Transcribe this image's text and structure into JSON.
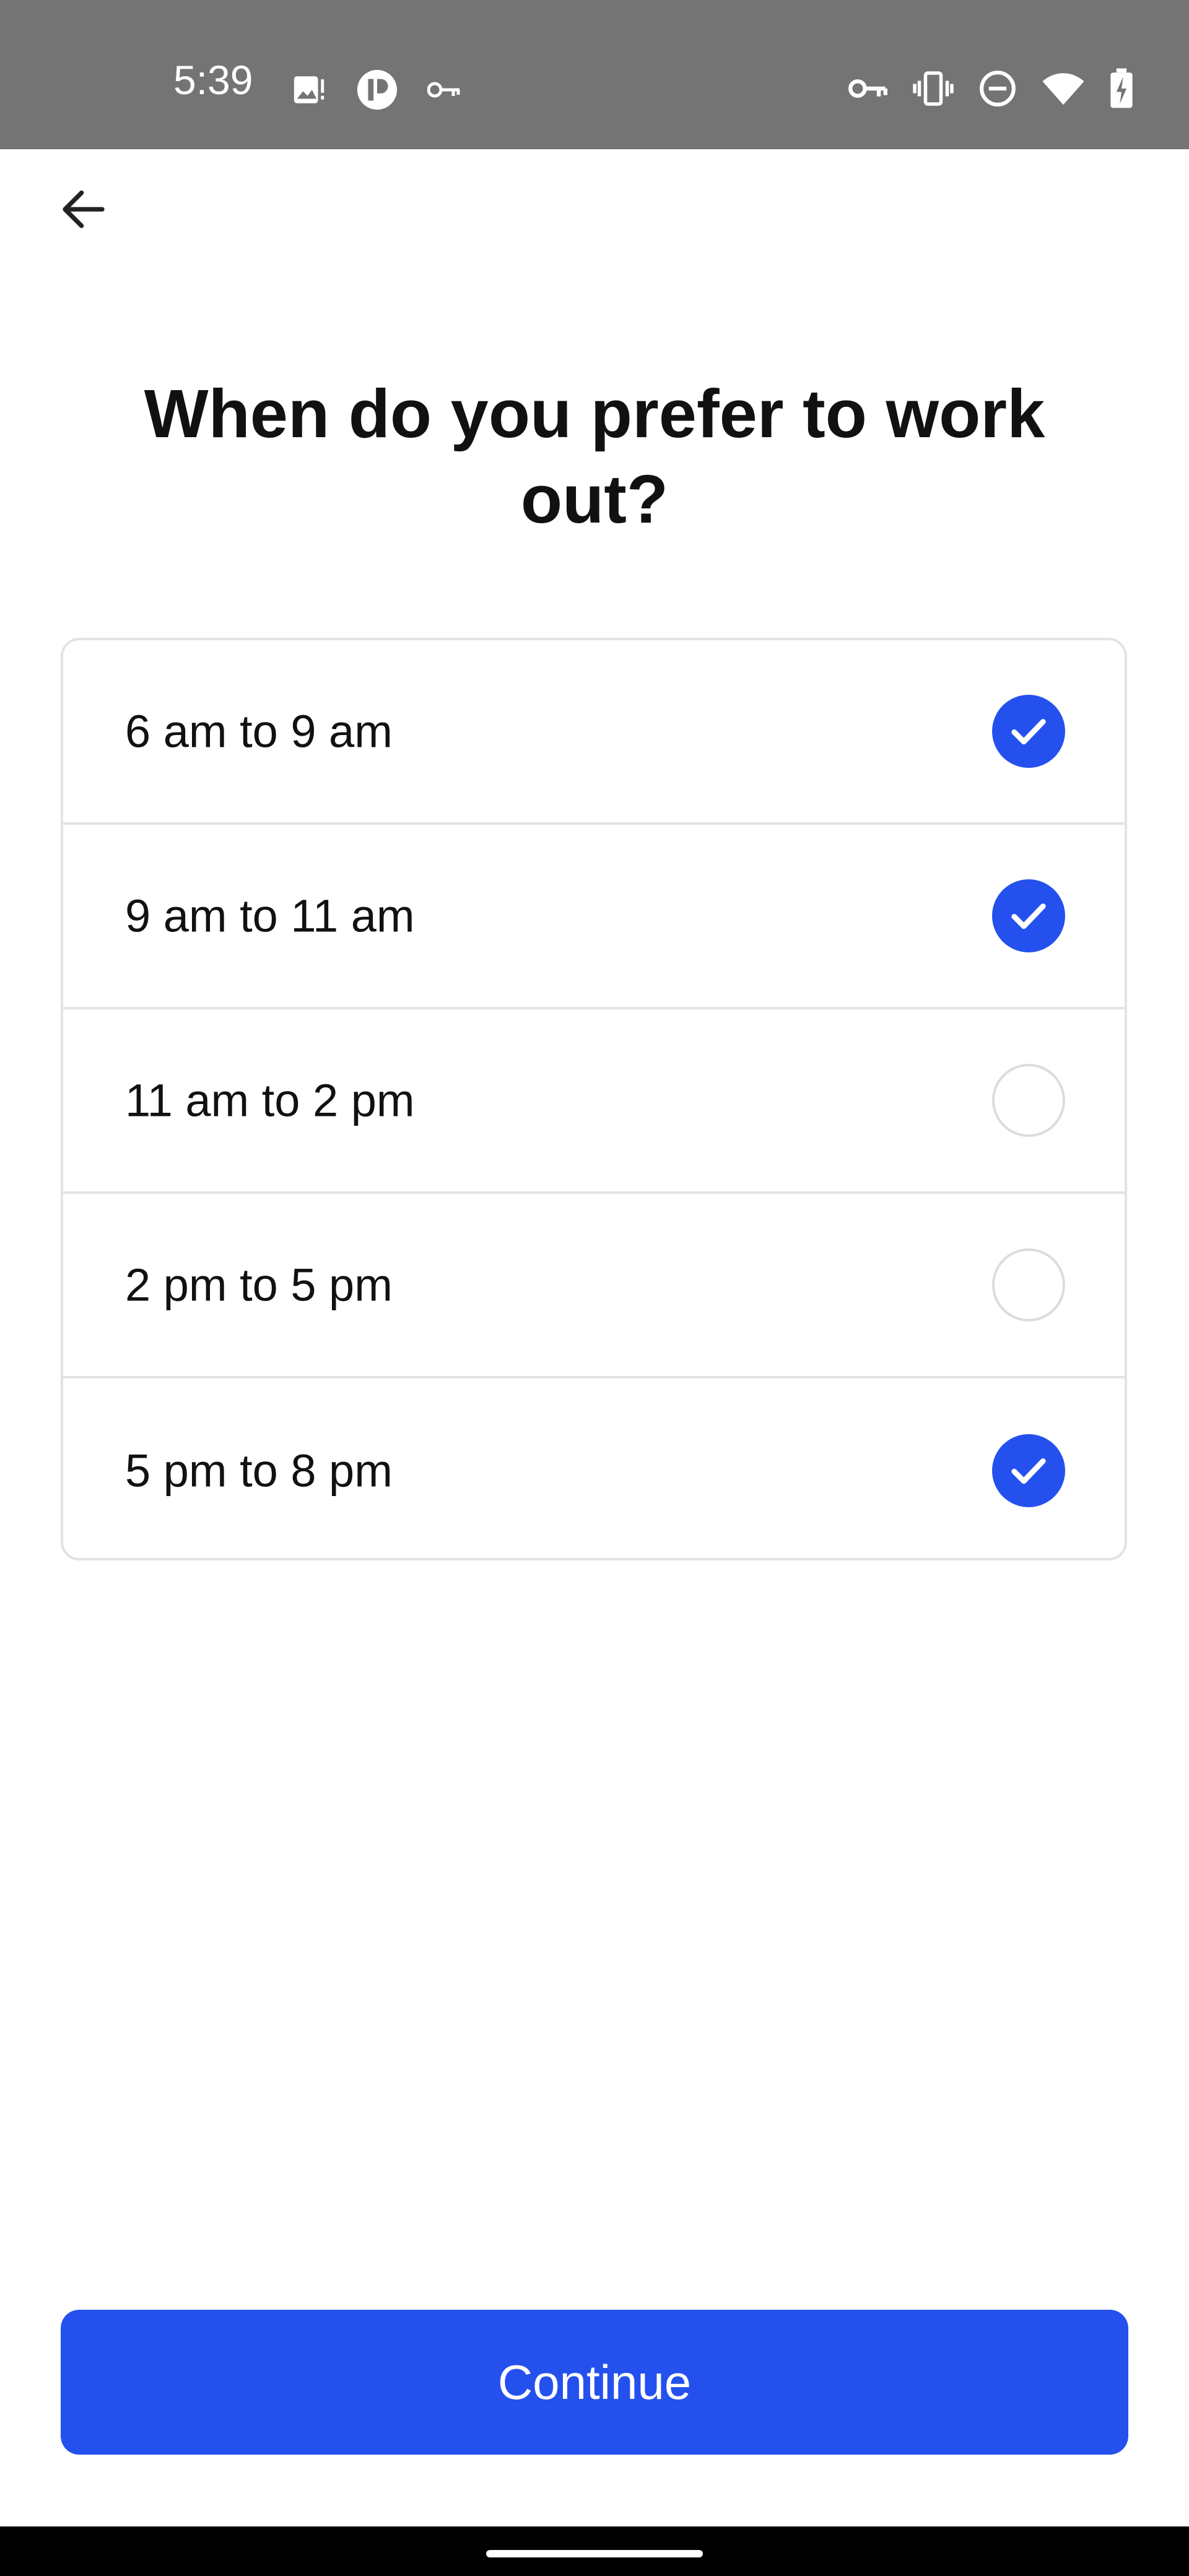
{
  "status_bar": {
    "time": "5:39",
    "left_icons": [
      "image-icon",
      "app-icon",
      "key-icon"
    ],
    "right_icons": [
      "vpn-key-icon",
      "vibrate-icon",
      "do-not-disturb-icon",
      "wifi-icon",
      "battery-charging-icon"
    ]
  },
  "header": {
    "back_icon": "arrow-left-icon"
  },
  "page": {
    "title": "When do you prefer to work out?"
  },
  "options": [
    {
      "label": "6 am to 9 am",
      "selected": true
    },
    {
      "label": "9 am to 11 am",
      "selected": true
    },
    {
      "label": "11 am to 2 pm",
      "selected": false
    },
    {
      "label": "2 pm to 5 pm",
      "selected": false
    },
    {
      "label": "5 pm to 8 pm",
      "selected": true
    }
  ],
  "footer": {
    "continue_label": "Continue"
  },
  "colors": {
    "accent": "#2451ee",
    "status_bar": "#747474",
    "border": "#e3e3e3"
  }
}
